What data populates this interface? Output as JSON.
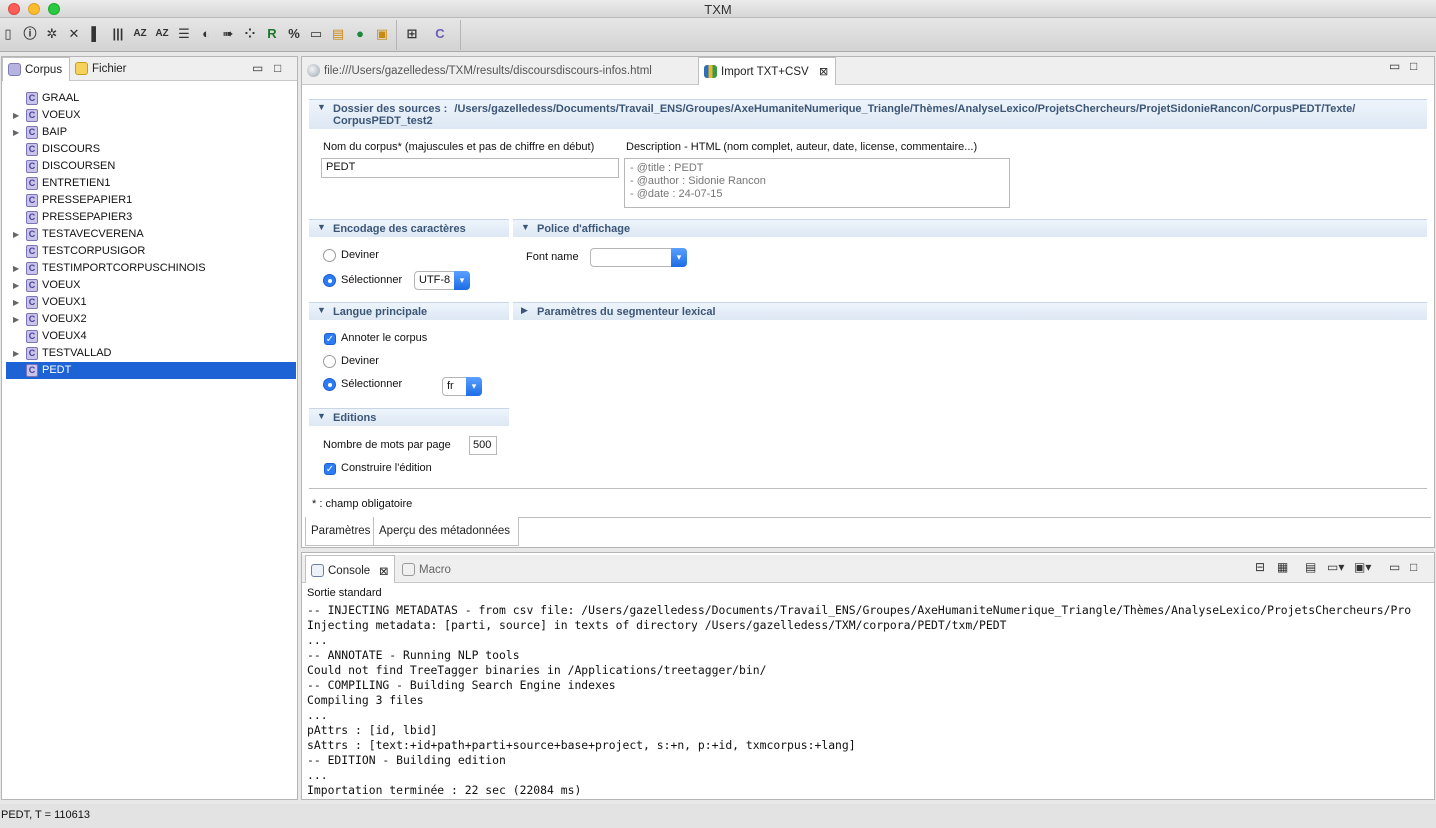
{
  "window": {
    "title": "TXM"
  },
  "toolbar": {
    "icons": [
      "book-icon",
      "info-icon",
      "gear-icon",
      "delete-icon",
      "columns-icon",
      "bars-icon",
      "az-icon",
      "az-sort-icon",
      "list-icon",
      "moon-icon",
      "arrow-icon",
      "scatter-icon",
      "refresh-icon",
      "link-icon",
      "new-file-icon",
      "export-icon",
      "go-icon",
      "import-icon",
      "perspective-icon",
      "corpus-perspective-icon"
    ]
  },
  "left_panel": {
    "tabs": [
      {
        "label": "Corpus"
      },
      {
        "label": "Fichier"
      }
    ],
    "tree": [
      {
        "label": "GRAAL",
        "expandable": false
      },
      {
        "label": "VOEUX",
        "expandable": true
      },
      {
        "label": "BAIP",
        "expandable": true
      },
      {
        "label": "DISCOURS",
        "expandable": false
      },
      {
        "label": "DISCOURSEN",
        "expandable": false
      },
      {
        "label": "ENTRETIEN1",
        "expandable": false
      },
      {
        "label": "PRESSEPAPIER1",
        "expandable": false
      },
      {
        "label": "PRESSEPAPIER3",
        "expandable": false
      },
      {
        "label": "TESTAVECVERENA",
        "expandable": true
      },
      {
        "label": "TESTCORPUSIGOR",
        "expandable": false
      },
      {
        "label": "TESTIMPORTCORPUSCHINOIS",
        "expandable": true
      },
      {
        "label": "VOEUX",
        "expandable": true
      },
      {
        "label": "VOEUX1",
        "expandable": true
      },
      {
        "label": "VOEUX2",
        "expandable": true
      },
      {
        "label": "VOEUX4",
        "expandable": false
      },
      {
        "label": "TESTVALLAD",
        "expandable": true
      },
      {
        "label": "PEDT",
        "expandable": false,
        "selected": true
      }
    ]
  },
  "editor": {
    "tabs": [
      {
        "label": "file:///Users/gazelledess/TXM/results/discoursdiscours-infos.html"
      },
      {
        "label": "Import TXT+CSV",
        "active": true
      }
    ],
    "sources": {
      "label": "Dossier des sources :",
      "path_line1": "/Users/gazelledess/Documents/Travail_ENS/Groupes/AxeHumaniteNumerique_Triangle/Thèmes/AnalyseLexico/ProjetsChercheurs/ProjetSidonieRancon/CorpusPEDT/Texte/",
      "path_line2": "CorpusPEDT_test2"
    },
    "corpus_name": {
      "label": "Nom du corpus* (majuscules et pas de chiffre en début)",
      "value": "PEDT"
    },
    "description": {
      "label": "Description - HTML (nom complet, auteur, date, license, commentaire...)",
      "line1": "- @title : PEDT",
      "line2": "- @author : Sidonie Rancon",
      "line3": "- @date : 24-07-15"
    },
    "encoding": {
      "title": "Encodage des caractères",
      "guess": "Deviner",
      "select": "Sélectionner",
      "value": "UTF-8"
    },
    "font": {
      "title": "Police d'affichage",
      "label": "Font name",
      "value": ""
    },
    "language": {
      "title": "Langue principale",
      "annotate": "Annoter le corpus",
      "guess": "Deviner",
      "select": "Sélectionner",
      "value": "fr"
    },
    "segmenter": {
      "title": "Paramètres du segmenteur lexical"
    },
    "editions": {
      "title": "Editions",
      "words_label": "Nombre de mots par page",
      "words_value": "500",
      "build": "Construire l'édition"
    },
    "required_note": "* : champ obligatoire",
    "bottom_tabs": [
      {
        "label": "Paramètres"
      },
      {
        "label": "Aperçu des métadonnées"
      }
    ]
  },
  "console": {
    "tabs": [
      {
        "label": "Console"
      },
      {
        "label": "Macro"
      }
    ],
    "header": "Sortie standard",
    "lines": [
      "-- INJECTING METADATAS - from csv file: /Users/gazelledess/Documents/Travail_ENS/Groupes/AxeHumaniteNumerique_Triangle/Thèmes/AnalyseLexico/ProjetsChercheurs/Pro",
      "Injecting metadata: [parti, source] in texts of directory /Users/gazelledess/TXM/corpora/PEDT/txm/PEDT",
      "...",
      "-- ANNOTATE - Running NLP tools",
      "Could not find TreeTagger binaries in /Applications/treetagger/bin/",
      "-- COMPILING - Building Search Engine indexes",
      "Compiling 3 files",
      "...",
      "pAttrs : [id, lbid]",
      "sAttrs : [text:+id+path+parti+source+base+project, s:+n, p:+id, txmcorpus:+lang]",
      "-- EDITION - Building edition",
      "...",
      "Importation terminée : 22 sec (22084 ms)"
    ]
  },
  "status": {
    "text": "PEDT, T = 110613"
  }
}
